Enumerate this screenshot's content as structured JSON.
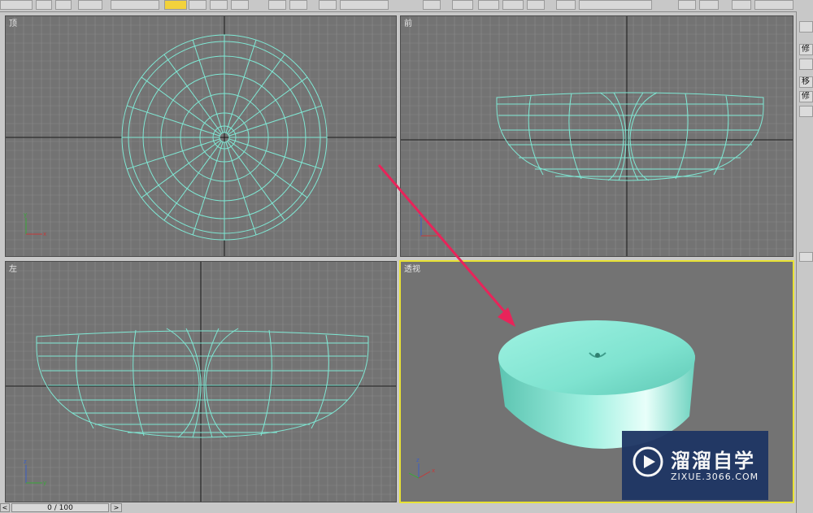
{
  "viewports": {
    "top": {
      "label": "顶"
    },
    "front": {
      "label": "前"
    },
    "left": {
      "label": "左"
    },
    "perspective": {
      "label": "透视"
    }
  },
  "command_panel": {
    "tabs": [
      "修",
      "",
      "移",
      "修",
      ""
    ]
  },
  "time_slider": {
    "frame": "0 / 100",
    "prev": "<",
    "next": ">"
  },
  "watermark": {
    "title": "溜溜自学",
    "subtitle": "ZIXUE.3066.COM"
  },
  "colors": {
    "wireframe": "#7fe8d4",
    "viewport_bg": "#737373",
    "grid": "#8a8a8a",
    "active_border": "#e8e234",
    "arrow": "#e8245a",
    "object_fill": "#7fe3d0"
  },
  "icons": [
    "link-icon",
    "unlink-icon",
    "bind-icon",
    "select-icon",
    "select-region-icon",
    "move-icon",
    "rotate-icon",
    "scale-icon",
    "mirror-icon",
    "align-icon",
    "material-editor-icon",
    "render-icon"
  ]
}
